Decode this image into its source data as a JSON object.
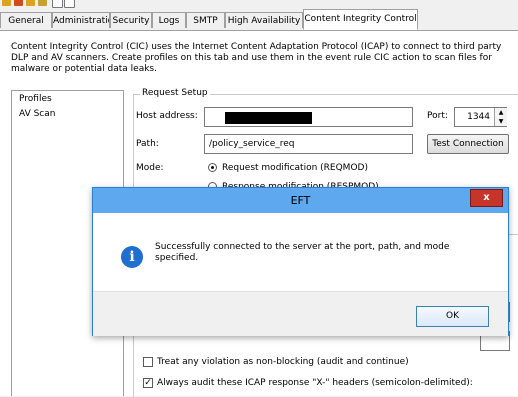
{
  "toolbar": {
    "icons": [
      "app-icon-1",
      "app-icon-2",
      "app-icon-3",
      "app-icon-4",
      "app-icon-5",
      "app-icon-6"
    ]
  },
  "tabs": [
    {
      "label": "General"
    },
    {
      "label": "Administration"
    },
    {
      "label": "Security"
    },
    {
      "label": "Logs"
    },
    {
      "label": "SMTP"
    },
    {
      "label": "High Availability"
    },
    {
      "label": "Content Integrity Control"
    }
  ],
  "description": "Content Integrity Control (CIC) uses the Internet Content Adaptation Protocol (ICAP) to connect to third party DLP and AV scanners. Create profiles on this tab and use them in the event rule CIC action to scan files for malware or potential data leaks.",
  "profiles": {
    "header": "Profiles",
    "items": [
      "AV Scan"
    ]
  },
  "request_setup": {
    "group_label": "Request Setup",
    "host_label": "Host address:",
    "host_value": "",
    "port_label": "Port:",
    "port_value": "1344",
    "path_label": "Path:",
    "path_value": "/policy_service_req",
    "test_button": "Test Connection",
    "mode_label": "Mode:",
    "mode_reqmod": "Request modification (REQMOD)",
    "mode_respmod": "Response modification (RESPMOD)"
  },
  "options": {
    "non_blocking": "Treat any violation as non-blocking (audit and continue)",
    "audit_headers": "Always audit these ICAP response \"X-\" headers (semicolon-delimited):"
  },
  "dialog": {
    "title": "EFT",
    "close_label": "x",
    "message": "Successfully connected to the server at the port, path, and mode specified.",
    "ok_label": "OK"
  }
}
